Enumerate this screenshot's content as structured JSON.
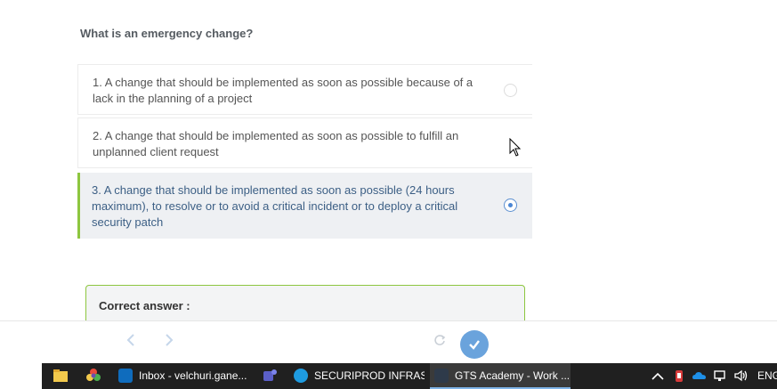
{
  "question": "What is an emergency change?",
  "options": [
    {
      "label": "1. A change that should be implemented as soon as possible because of a lack in the planning of a project",
      "selected": false
    },
    {
      "label": "2. A change that should be implemented as soon as possible to fulfill an unplanned client request",
      "selected": false
    },
    {
      "label": "3. A change that should be implemented as soon as possible (24 hours maximum), to resolve or to avoid a critical incident or to deploy a critical security patch",
      "selected": true
    }
  ],
  "answer": {
    "title": "Correct answer :"
  },
  "footer": {
    "prev_icon": "chevron-left-icon",
    "next_icon": "chevron-right-icon",
    "refresh_icon": "refresh-icon",
    "submit_icon": "check-icon"
  },
  "taskbar": {
    "apps": [
      {
        "label": "Inbox - velchuri.gane...",
        "icon": "outlook-icon"
      },
      {
        "label": "SECURIPROD INFRAS...",
        "icon": "edge-icon"
      },
      {
        "label": "GTS Academy - Work ...",
        "icon": "gts-academy-icon",
        "active": true
      }
    ],
    "language": "ENG"
  },
  "colors": {
    "accent_green": "#8dc63f",
    "selected_bg": "#eef0f3",
    "selected_text": "#3c5f85",
    "submit_blue": "#6aa3dc"
  }
}
